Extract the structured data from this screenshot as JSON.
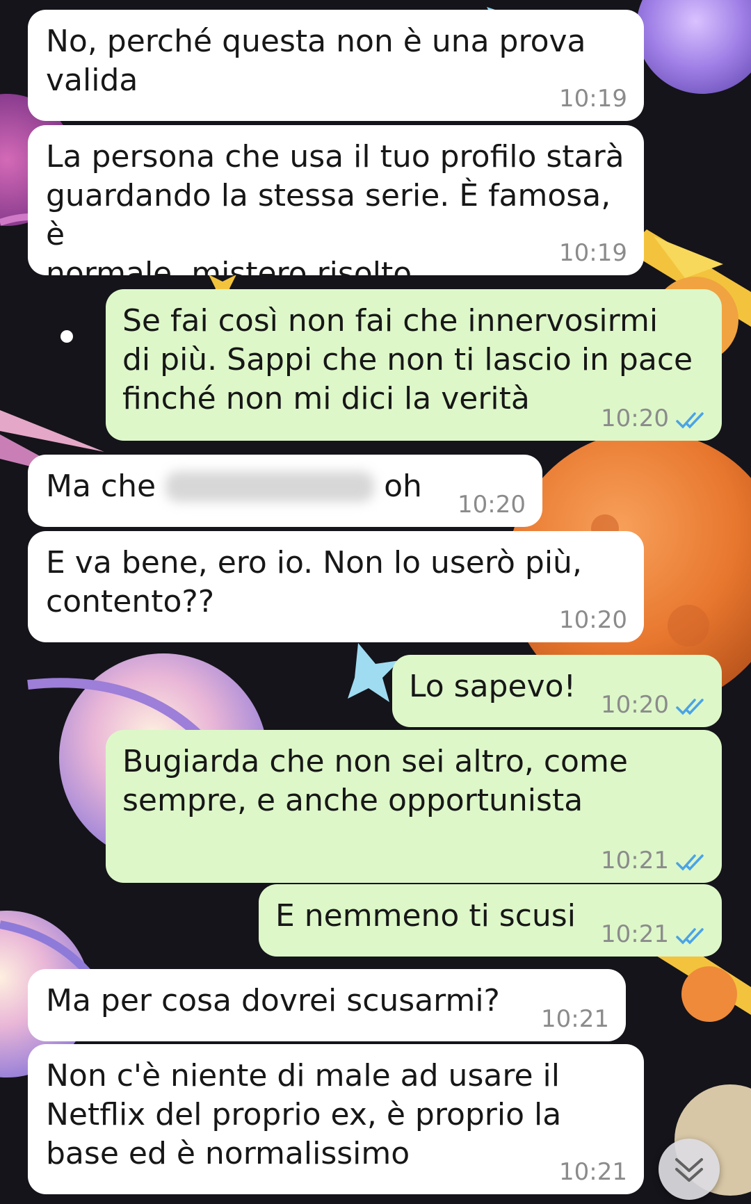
{
  "messages": [
    {
      "id": "m1",
      "direction": "in",
      "text": "No, perché questa non è una prova\nvalida",
      "time": "10:19"
    },
    {
      "id": "m2",
      "direction": "in",
      "text": "La persona che usa il tuo profilo starà\nguardando la stessa serie. È famosa, è\nnormale, mistero risolto",
      "time": "10:19"
    },
    {
      "id": "m3",
      "direction": "out",
      "text": "Se fai così non fai che innervosirmi\ndi più. Sappi che non ti lascio in pace\nfinché non mi dici la verità",
      "time": "10:20",
      "status": "read"
    },
    {
      "id": "m4",
      "direction": "in",
      "text_before": "Ma che",
      "text_after": "oh",
      "redacted": true,
      "time": "10:20"
    },
    {
      "id": "m5",
      "direction": "in",
      "text": "E va bene, ero io. Non lo userò più,\ncontento??",
      "time": "10:20"
    },
    {
      "id": "m6",
      "direction": "out",
      "text": "Lo sapevo!",
      "time": "10:20",
      "status": "read"
    },
    {
      "id": "m7",
      "direction": "out",
      "text": "Bugiarda che non sei altro, come\nsempre, e anche opportunista",
      "time": "10:21",
      "status": "read"
    },
    {
      "id": "m8",
      "direction": "out",
      "text": "E nemmeno ti scusi",
      "time": "10:21",
      "status": "read"
    },
    {
      "id": "m9",
      "direction": "in",
      "text": "Ma per cosa dovrei scusarmi?",
      "time": "10:21"
    },
    {
      "id": "m10",
      "direction": "in",
      "text": "Non c'è niente di male ad usare il\nNetflix del proprio ex, è proprio la\nbase ed è normalissimo",
      "time": "10:21"
    }
  ],
  "icons": {
    "read_receipt": "double-check-icon",
    "scroll_down": "chevron-double-down-icon"
  },
  "colors": {
    "incoming_bubble": "#ffffff",
    "outgoing_bubble": "#ddf7c9",
    "read_check": "#4aa3e6",
    "wallpaper": "#15141a"
  }
}
